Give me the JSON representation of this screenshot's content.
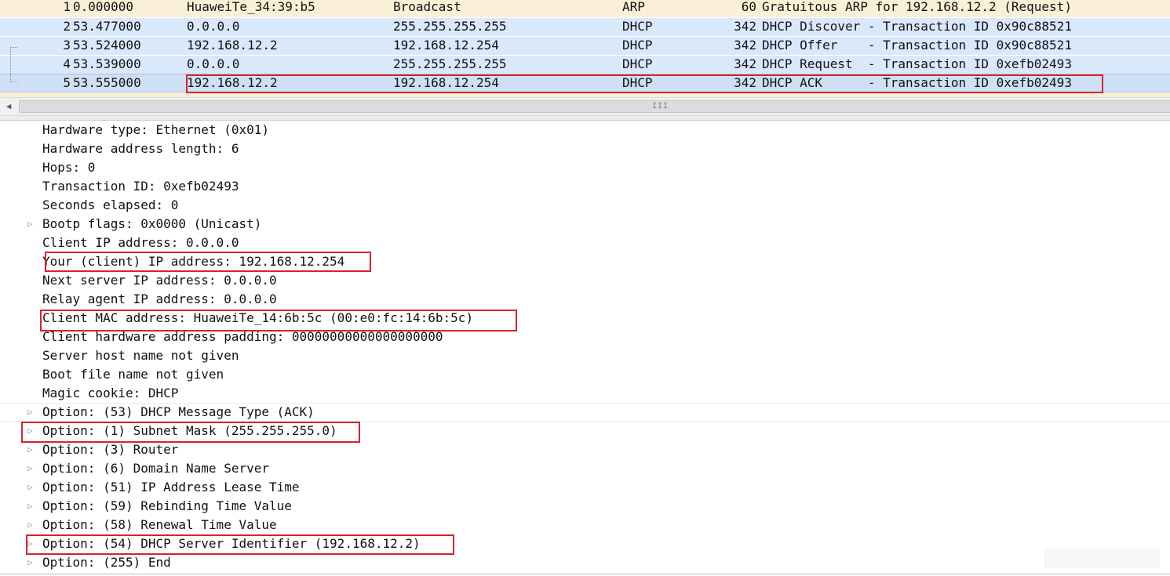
{
  "packets": [
    {
      "no": "1",
      "time": "0.000000",
      "source": "HuaweiTe_34:39:b5",
      "destination": "Broadcast",
      "protocol": "ARP",
      "length": "60",
      "info": "Gratuitous ARP for 192.168.12.2 (Request)"
    },
    {
      "no": "2",
      "time": "53.477000",
      "source": "0.0.0.0",
      "destination": "255.255.255.255",
      "protocol": "DHCP",
      "length": "342",
      "info": "DHCP Discover - Transaction ID 0x90c88521"
    },
    {
      "no": "3",
      "time": "53.524000",
      "source": "192.168.12.2",
      "destination": "192.168.12.254",
      "protocol": "DHCP",
      "length": "342",
      "info": "DHCP Offer    - Transaction ID 0x90c88521"
    },
    {
      "no": "4",
      "time": "53.539000",
      "source": "0.0.0.0",
      "destination": "255.255.255.255",
      "protocol": "DHCP",
      "length": "342",
      "info": "DHCP Request  - Transaction ID 0xefb02493"
    },
    {
      "no": "5",
      "time": "53.555000",
      "source": "192.168.12.2",
      "destination": "192.168.12.254",
      "protocol": "DHCP",
      "length": "342",
      "info": "DHCP ACK      - Transaction ID 0xefb02493"
    }
  ],
  "scrollbar": {
    "left_arrow_icon": "arrow-left-icon",
    "grip_glyph": "III"
  },
  "detail_lines": [
    {
      "text": "Hardware type: Ethernet (0x01)",
      "expandable": false
    },
    {
      "text": "Hardware address length: 6",
      "expandable": false
    },
    {
      "text": "Hops: 0",
      "expandable": false
    },
    {
      "text": "Transaction ID: 0xefb02493",
      "expandable": false
    },
    {
      "text": "Seconds elapsed: 0",
      "expandable": false
    },
    {
      "text": "Bootp flags: 0x0000 (Unicast)",
      "expandable": true
    },
    {
      "text": "Client IP address: 0.0.0.0",
      "expandable": false
    },
    {
      "text": "Your (client) IP address: 192.168.12.254",
      "expandable": false
    },
    {
      "text": "Next server IP address: 0.0.0.0",
      "expandable": false
    },
    {
      "text": "Relay agent IP address: 0.0.0.0",
      "expandable": false
    },
    {
      "text": "Client MAC address: HuaweiTe_14:6b:5c (00:e0:fc:14:6b:5c)",
      "expandable": false
    },
    {
      "text": "Client hardware address padding: 00000000000000000000",
      "expandable": false
    },
    {
      "text": "Server host name not given",
      "expandable": false
    },
    {
      "text": "Boot file name not given",
      "expandable": false
    },
    {
      "text": "Magic cookie: DHCP",
      "expandable": false
    },
    {
      "text": "Option: (53) DHCP Message Type (ACK)",
      "expandable": true
    },
    {
      "text": "Option: (1) Subnet Mask (255.255.255.0)",
      "expandable": true
    },
    {
      "text": "Option: (3) Router",
      "expandable": true
    },
    {
      "text": "Option: (6) Domain Name Server",
      "expandable": true
    },
    {
      "text": "Option: (51) IP Address Lease Time",
      "expandable": true
    },
    {
      "text": "Option: (59) Rebinding Time Value",
      "expandable": true
    },
    {
      "text": "Option: (58) Renewal Time Value",
      "expandable": true
    },
    {
      "text": "Option: (54) DHCP Server Identifier (192.168.12.2)",
      "expandable": true
    },
    {
      "text": "Option: (255) End",
      "expandable": true
    }
  ],
  "icons": {
    "expander": "triangle-right-icon"
  },
  "colors": {
    "arp_row_bg": "#faf0d7",
    "dhcp_row_bg": "#dae8fc",
    "annotation_red": "#d8222b"
  }
}
